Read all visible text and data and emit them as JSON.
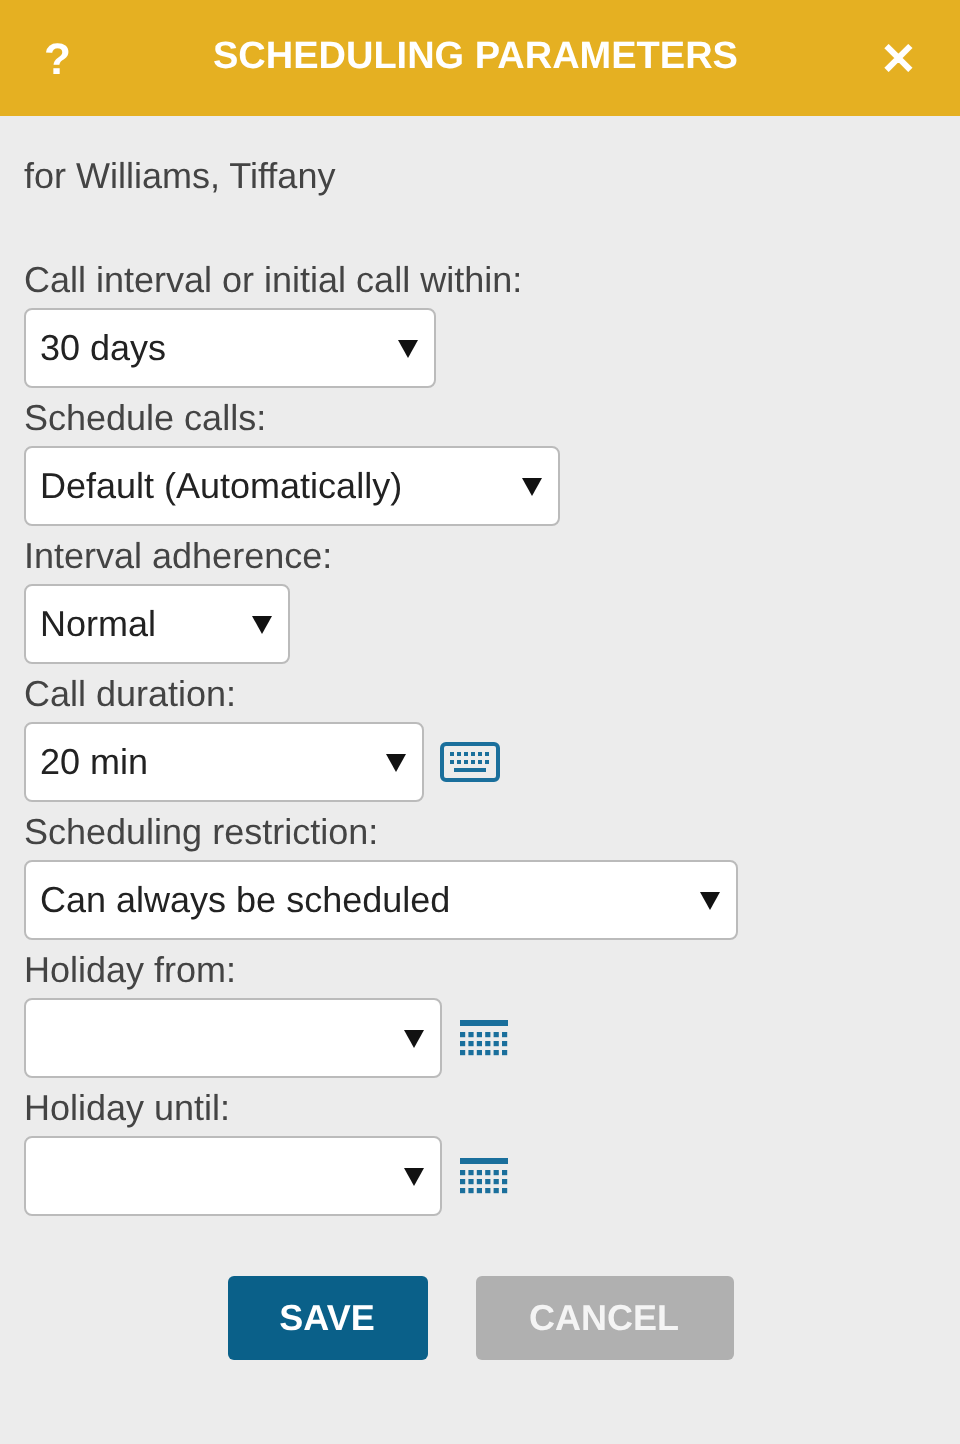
{
  "dialog": {
    "help": "?",
    "title": "SCHEDULING PARAMETERS",
    "close": "✕"
  },
  "subtitle": "for Williams, Tiffany",
  "fields": [
    {
      "label": "Call interval or initial call within:",
      "value": "30 days",
      "kind": "plain"
    },
    {
      "label": "Schedule calls:",
      "value": "Default (Automatically)",
      "kind": "plain"
    },
    {
      "label": "Interval adherence:",
      "value": "Normal",
      "kind": "plain"
    },
    {
      "label": "Call duration:",
      "value": "20 min",
      "kind": "keyboard"
    },
    {
      "label": "Scheduling restriction:",
      "value": "Can always be scheduled",
      "kind": "plain"
    },
    {
      "label": "Holiday from:",
      "kind": "calendar"
    },
    {
      "label": "Holiday until:",
      "kind": "calendar"
    }
  ],
  "buttons": [
    {
      "label": "SAVE",
      "kind": "primary"
    },
    {
      "label": "CANCEL",
      "kind": "secondary"
    }
  ]
}
